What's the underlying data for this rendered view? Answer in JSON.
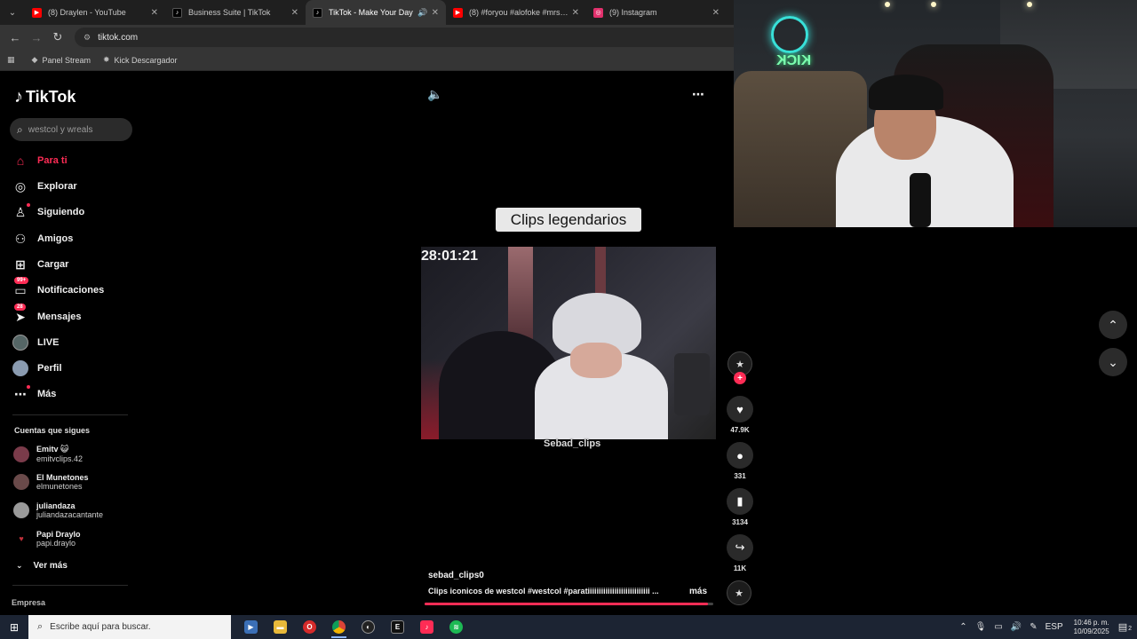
{
  "browser": {
    "tabs": [
      {
        "label": "(8) Draylen - YouTube",
        "favicon_color": "#ff0000",
        "active": false
      },
      {
        "label": "Business Suite | TikTok",
        "favicon_color": "#000000",
        "active": false
      },
      {
        "label": "TikTok - Make Your Day",
        "favicon_color": "#000000",
        "active": true
      },
      {
        "label": "(8) #foryou #alofoke #mrstiven...",
        "favicon_color": "#ff0000",
        "active": false
      },
      {
        "label": "(9) Instagram",
        "favicon_color": "#e1306c",
        "active": false
      }
    ],
    "url": "tiktok.com",
    "bookmarks": [
      {
        "label": "Panel Stream",
        "icon": "diamond-icon"
      },
      {
        "label": "Kick Descargador",
        "icon": "kick-icon"
      }
    ]
  },
  "tiktok": {
    "logo_text": "TikTok",
    "search_placeholder": "westcol y wreals",
    "nav": [
      {
        "label": "Para ti",
        "icon": "home-icon",
        "active": true
      },
      {
        "label": "Explorar",
        "icon": "compass-icon"
      },
      {
        "label": "Siguiendo",
        "icon": "following-icon"
      },
      {
        "label": "Amigos",
        "icon": "friends-icon"
      },
      {
        "label": "Cargar",
        "icon": "upload-icon"
      },
      {
        "label": "Notificaciones",
        "icon": "notifications-icon",
        "badge": "99+"
      },
      {
        "label": "Mensajes",
        "icon": "messages-icon",
        "badge": "28"
      },
      {
        "label": "LIVE",
        "icon": "live-icon"
      },
      {
        "label": "Perfil",
        "icon": "profile-icon"
      },
      {
        "label": "Más",
        "icon": "more-icon"
      }
    ],
    "following_title": "Cuentas que sigues",
    "following": [
      {
        "name": "Emitv 😺",
        "user": "emitvclips.42"
      },
      {
        "name": "El Munetones",
        "user": "elmunetones"
      },
      {
        "name": "juliandaza",
        "user": "juliandazacantante"
      },
      {
        "name": "Papi Draylo",
        "user": "papi.draylo"
      }
    ],
    "see_more": "Ver más",
    "company": "Empresa",
    "accent": "#fe2c55"
  },
  "video": {
    "caption_top": "Clips legendarios",
    "timestamp": "28:01:21",
    "watermark": "Sebad_clips",
    "author": "sebad_clips0",
    "description": "Clips iconicos de westcol #westcol #paratiiiiiiiiiiiiiiiiiiiiiiiiiiii ...",
    "more": "más",
    "progress": 0.98,
    "actions": {
      "likes": "47.9K",
      "comments": "331",
      "saves": "3134",
      "shares": "11K"
    }
  },
  "taskbar": {
    "search_placeholder": "Escribe aquí para buscar.",
    "lang": "ESP",
    "time": "10:46 p. m.",
    "date": "10/09/2025",
    "notification_count": "2"
  }
}
